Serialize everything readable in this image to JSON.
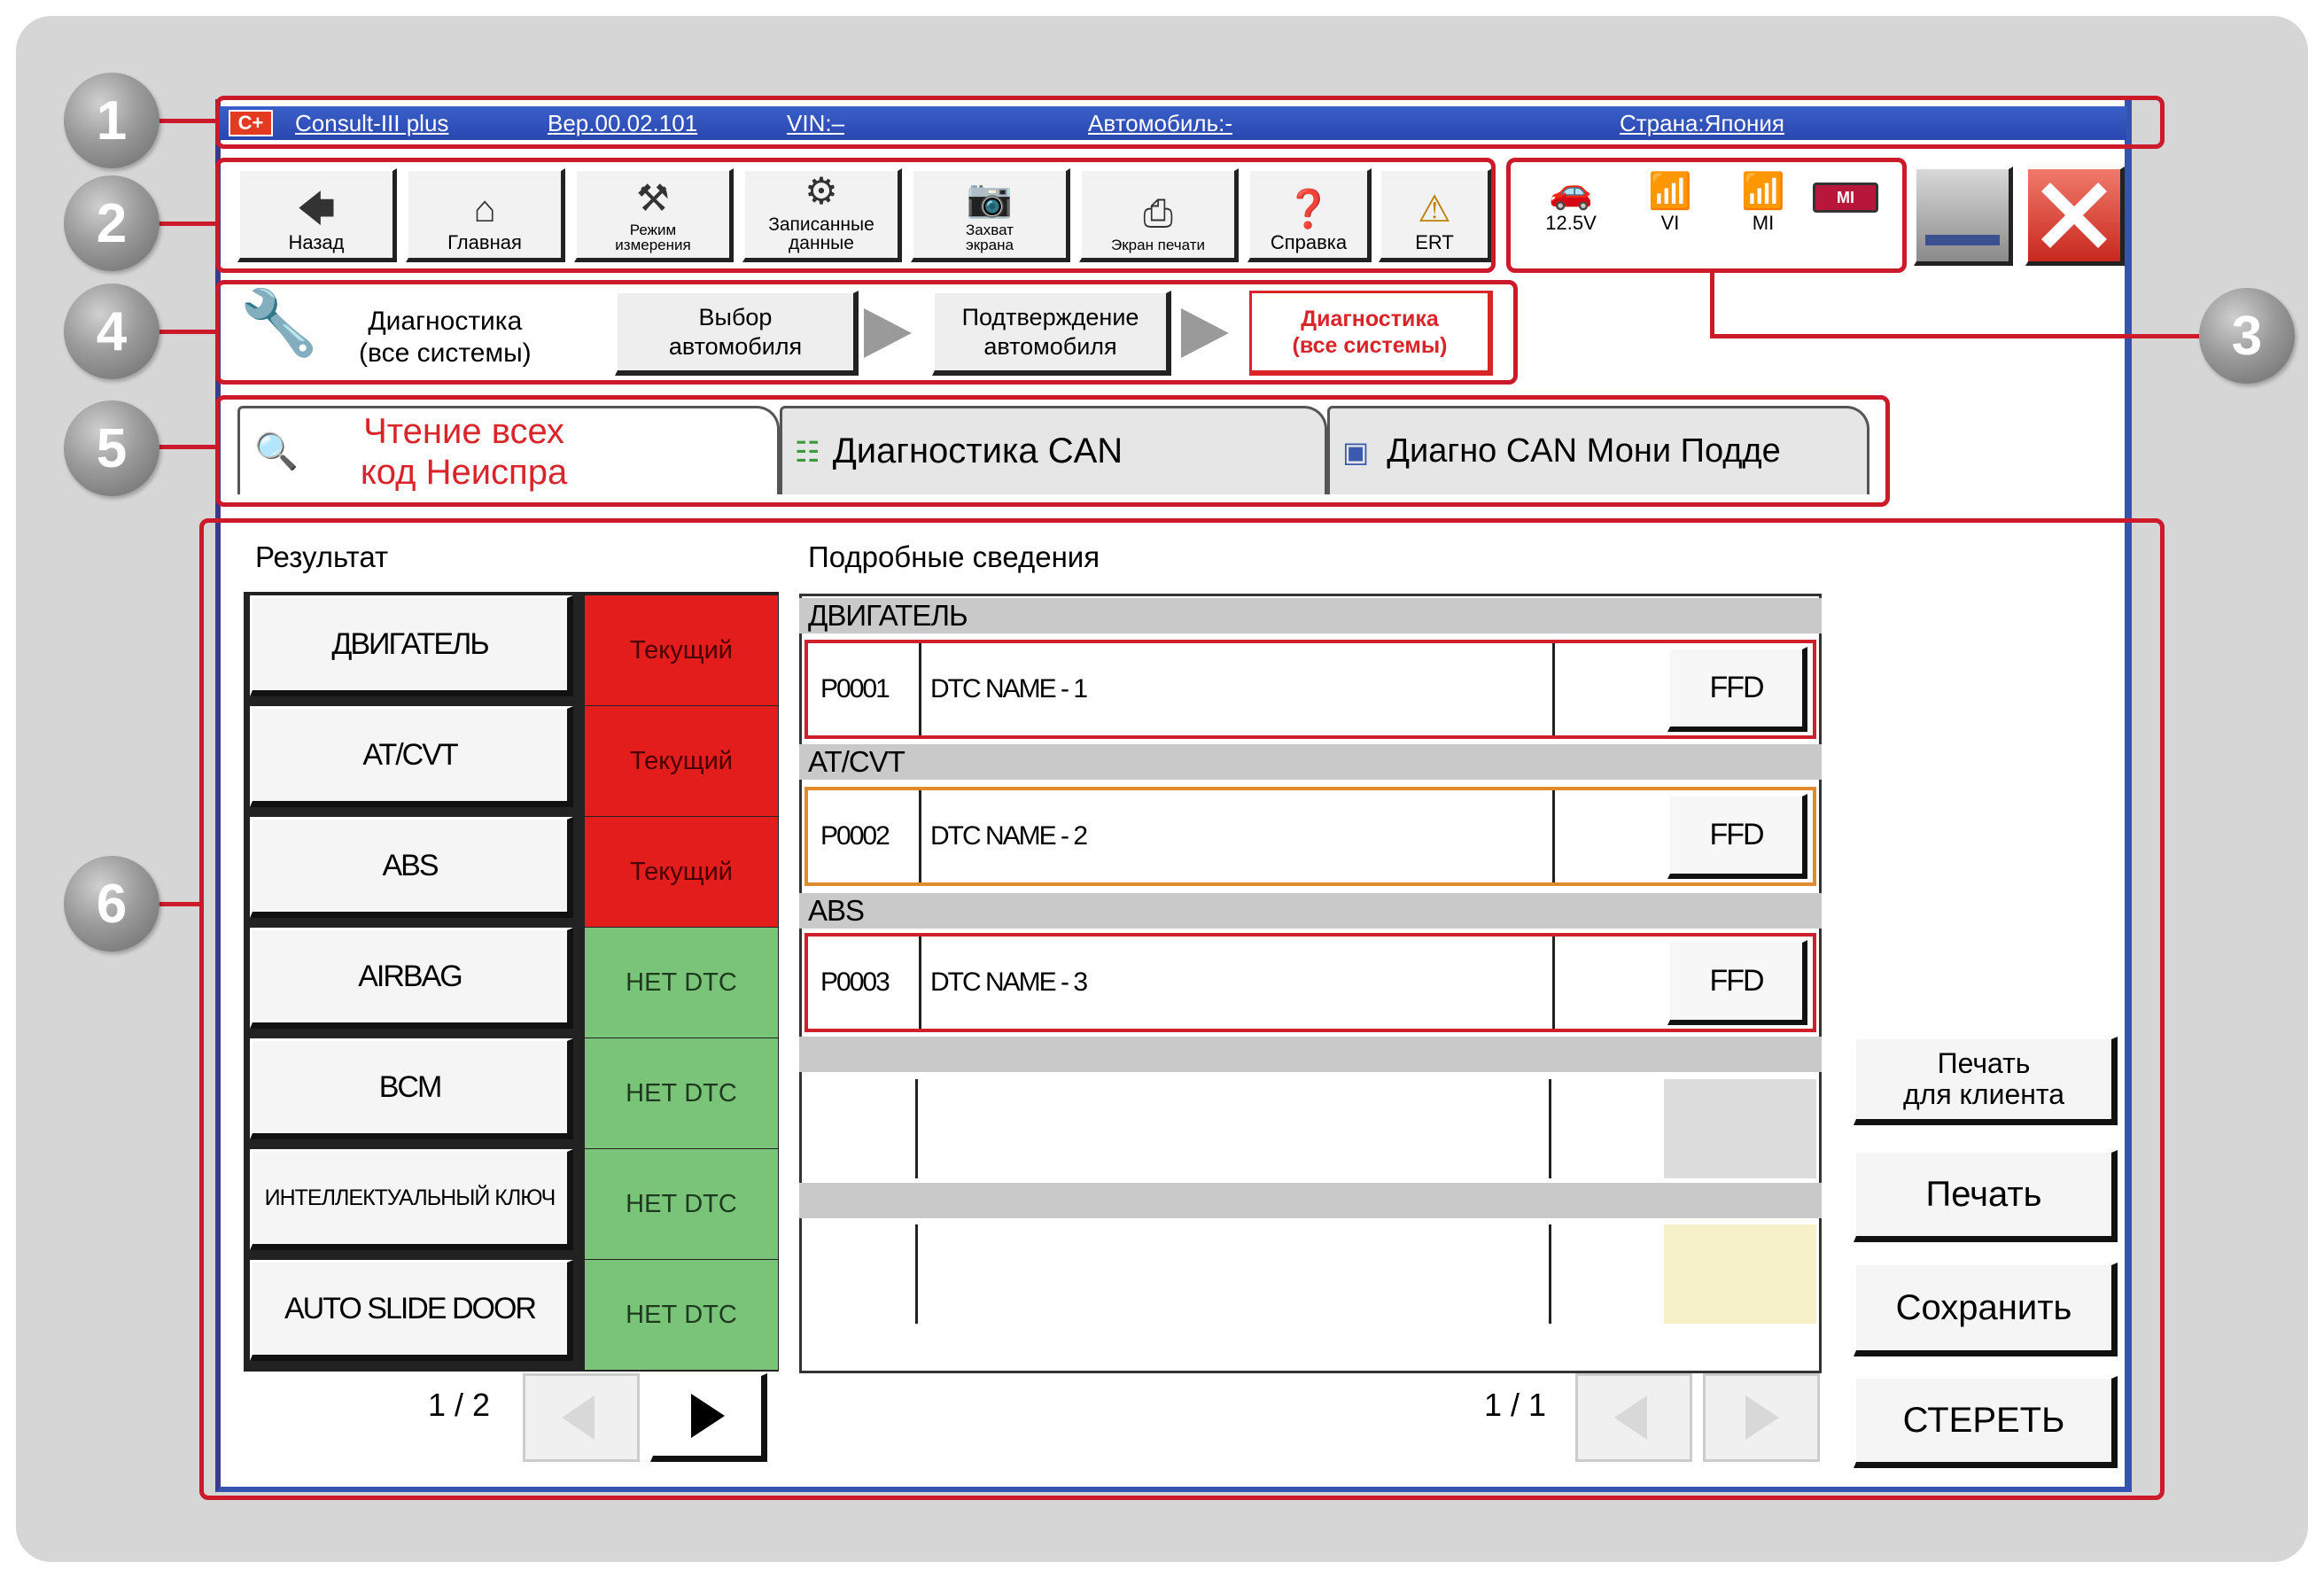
{
  "titlebar": {
    "app": "Consult-III plus",
    "version": "Вер.00.02.101",
    "vin": "VIN:–",
    "vehicle": "Автомобиль:-",
    "country": "Страна:Япония",
    "logo": "C+"
  },
  "toolbar": {
    "back": "Назад",
    "home": "Главная",
    "mode_l1": "Режим",
    "mode_l2": "измерения",
    "recorded_l1": "Записанные",
    "recorded_l2": "данные",
    "capture_l1": "Захват",
    "capture_l2": "экрана",
    "print_screen": "Экран печати",
    "help": "Справка",
    "ert": "ERT"
  },
  "status": {
    "battery": "12.5V",
    "vi": "VI",
    "mi": "MI",
    "mi_badge": "MI"
  },
  "breadcrumb": {
    "current_l1": "Диагностика",
    "current_l2": "(все системы)",
    "step1_l1": "Выбор",
    "step1_l2": "автомобиля",
    "step2_l1": "Подтверждение",
    "step2_l2": "автомобиля",
    "step3_l1": "Диагностика",
    "step3_l2": "(все системы)"
  },
  "tabs": {
    "tab1_l1": "Чтение всех",
    "tab1_l2": "код Неиспра",
    "tab2": "Диагностика CAN",
    "tab3": "Диагно CAN Мони Подде"
  },
  "results": {
    "header": "Результат",
    "systems": [
      {
        "name": "ДВИГАТЕЛЬ",
        "status": "Текущий"
      },
      {
        "name": "AT/CVT",
        "status": "Текущий"
      },
      {
        "name": "ABS",
        "status": "Текущий"
      },
      {
        "name": "AIRBAG",
        "status": "НЕТ DTC"
      },
      {
        "name": "BCM",
        "status": "НЕТ DTC"
      },
      {
        "name": "ИНТЕЛЛЕКТУАЛЬНЫЙ КЛЮЧ",
        "status": "НЕТ DTC"
      },
      {
        "name": "AUTO SLIDE DOOR",
        "status": "НЕТ DTC"
      }
    ],
    "page": "1 / 2"
  },
  "details": {
    "header": "Подробные сведения",
    "groups": [
      {
        "name": "ДВИГАТЕЛЬ",
        "code": "P0001",
        "dtc": "DTC NAME - 1",
        "button": "FFD"
      },
      {
        "name": "AT/CVT",
        "code": "P0002",
        "dtc": "DTC NAME - 2",
        "button": "FFD"
      },
      {
        "name": "ABS",
        "code": "P0003",
        "dtc": "DTC NAME - 3",
        "button": "FFD"
      }
    ],
    "page": "1 / 1"
  },
  "actions": {
    "print_client_l1": "Печать",
    "print_client_l2": "для клиента",
    "print": "Печать",
    "save": "Сохранить",
    "erase": "СТЕРЕТЬ"
  },
  "callouts": [
    "1",
    "2",
    "3",
    "4",
    "5",
    "6"
  ],
  "colors": {
    "callout_line": "#cc1a2a",
    "status_current": "#e31c1c",
    "status_no_dtc": "#7ac47a",
    "titlebar": "#2a47b0"
  }
}
